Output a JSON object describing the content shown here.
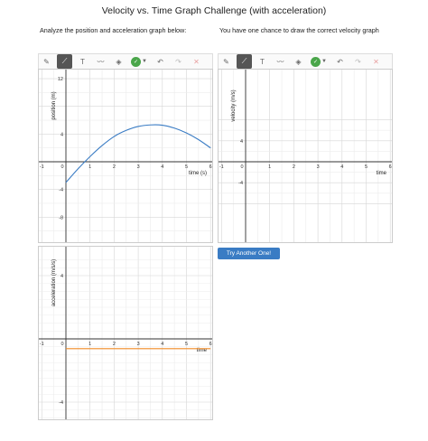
{
  "page": {
    "title": "Velocity vs. Time Graph Challenge (with acceleration)",
    "left_instruction": "Analyze the position and acceleration graph below:",
    "right_instruction": "You have one chance to draw the correct velocity graph",
    "try_button": "Try Another One!"
  },
  "toolbar_icons": [
    "pencil-icon",
    "line-icon",
    "text-icon",
    "freehand-icon",
    "eraser-icon",
    "color-icon",
    "undo-icon",
    "redo-icon",
    "delete-icon"
  ],
  "colors": {
    "curve": "#3a7cc4",
    "accel": "#f08a24",
    "button": "#3a7cc4",
    "color_dot": "#4aa64a"
  },
  "chart_data": [
    {
      "id": "position",
      "type": "line",
      "ylabel": "position (m)",
      "xlabel": "time (s)",
      "xlim": [
        -1,
        6
      ],
      "ylim": [
        -12,
        12
      ],
      "x_ticks": [
        -1,
        0,
        1,
        2,
        3,
        4,
        5,
        6
      ],
      "y_ticks": [
        12,
        4,
        -4,
        -8,
        -12
      ],
      "series": [
        {
          "x": [
            0,
            0.5,
            1,
            1.5,
            2,
            2.5,
            3,
            3.5,
            4,
            4.5,
            5,
            5.5,
            6
          ],
          "y": [
            -3,
            -1.03,
            0.75,
            2.34,
            3.65,
            4.53,
            5.1,
            5.32,
            5.28,
            4.86,
            4.16,
            3.2,
            2.0
          ]
        }
      ]
    },
    {
      "id": "velocity",
      "type": "line",
      "ylabel": "velocity (m/s)",
      "xlabel": "time",
      "xlim": [
        -1,
        6
      ],
      "ylim": [
        -8,
        8
      ],
      "x_ticks": [
        -1,
        0,
        1,
        2,
        3,
        4,
        5,
        6
      ],
      "y_ticks": [
        4,
        -4
      ],
      "series": []
    },
    {
      "id": "acceleration",
      "type": "line",
      "ylabel": "acceleration (m/s/s)",
      "xlabel": "time",
      "xlim": [
        -1,
        6
      ],
      "ylim": [
        -5,
        5
      ],
      "x_ticks": [
        -1,
        0,
        1,
        2,
        3,
        4,
        5,
        6
      ],
      "y_ticks": [
        4,
        -4
      ],
      "series": [
        {
          "x": [
            0,
            6
          ],
          "y": [
            -0.62,
            -0.62
          ]
        }
      ]
    }
  ]
}
